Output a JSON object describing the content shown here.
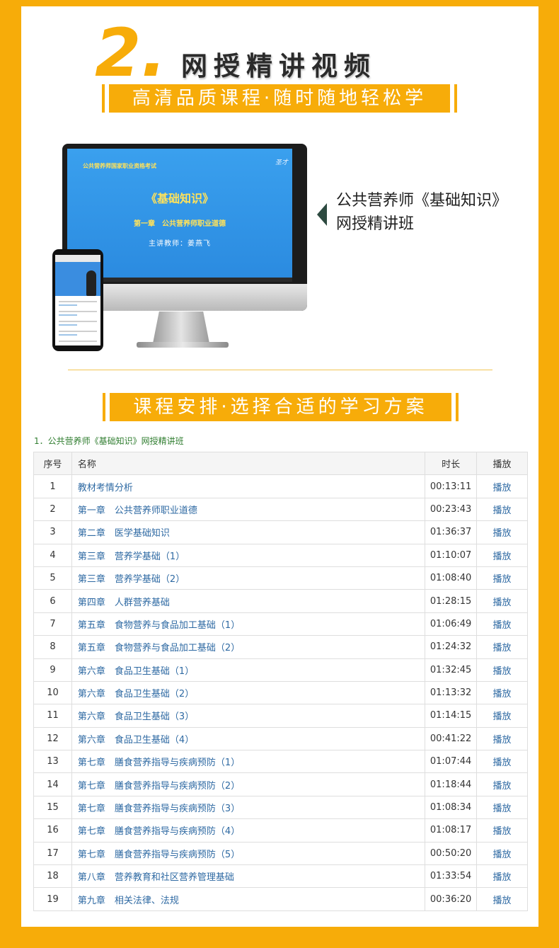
{
  "header": {
    "number": "2.",
    "title": "网授精讲视频",
    "banner": "高清品质课程·随时随地轻松学"
  },
  "device": {
    "screen_top": "公共营养师国家职业资格考试",
    "screen_logo": "圣才",
    "screen_course": "《基础知识》",
    "screen_chapter": "第一章　公共营养师职业道德",
    "screen_teacher": "主讲教师：姜燕飞"
  },
  "product": {
    "line1": "公共营养师《基础知识》",
    "line2": "网授精讲班"
  },
  "section": {
    "banner": "课程安排·选择合适的学习方案",
    "subtitle": "1．公共营养师《基础知识》网授精讲班"
  },
  "table": {
    "headers": [
      "序号",
      "名称",
      "时长",
      "播放"
    ],
    "rows": [
      {
        "no": "1",
        "name": "教材考情分析",
        "duration": "00:13:11",
        "play": "播放"
      },
      {
        "no": "2",
        "name": "第一章　公共营养师职业道德",
        "duration": "00:23:43",
        "play": "播放"
      },
      {
        "no": "3",
        "name": "第二章　医学基础知识",
        "duration": "01:36:37",
        "play": "播放"
      },
      {
        "no": "4",
        "name": "第三章　营养学基础（1）",
        "duration": "01:10:07",
        "play": "播放"
      },
      {
        "no": "5",
        "name": "第三章　营养学基础（2）",
        "duration": "01:08:40",
        "play": "播放"
      },
      {
        "no": "6",
        "name": "第四章　人群营养基础",
        "duration": "01:28:15",
        "play": "播放"
      },
      {
        "no": "7",
        "name": "第五章　食物营养与食品加工基础（1）",
        "duration": "01:06:49",
        "play": "播放"
      },
      {
        "no": "8",
        "name": "第五章　食物营养与食品加工基础（2）",
        "duration": "01:24:32",
        "play": "播放"
      },
      {
        "no": "9",
        "name": "第六章　食品卫生基础（1）",
        "duration": "01:32:45",
        "play": "播放"
      },
      {
        "no": "10",
        "name": "第六章　食品卫生基础（2）",
        "duration": "01:13:32",
        "play": "播放"
      },
      {
        "no": "11",
        "name": "第六章　食品卫生基础（3）",
        "duration": "01:14:15",
        "play": "播放"
      },
      {
        "no": "12",
        "name": "第六章　食品卫生基础（4）",
        "duration": "00:41:22",
        "play": "播放"
      },
      {
        "no": "13",
        "name": "第七章　膳食营养指导与疾病预防（1）",
        "duration": "01:07:44",
        "play": "播放"
      },
      {
        "no": "14",
        "name": "第七章　膳食营养指导与疾病预防（2）",
        "duration": "01:18:44",
        "play": "播放"
      },
      {
        "no": "15",
        "name": "第七章　膳食营养指导与疾病预防（3）",
        "duration": "01:08:34",
        "play": "播放"
      },
      {
        "no": "16",
        "name": "第七章　膳食营养指导与疾病预防（4）",
        "duration": "01:08:17",
        "play": "播放"
      },
      {
        "no": "17",
        "name": "第七章　膳食营养指导与疾病预防（5）",
        "duration": "00:50:20",
        "play": "播放"
      },
      {
        "no": "18",
        "name": "第八章　营养教育和社区营养管理基础",
        "duration": "01:33:54",
        "play": "播放"
      },
      {
        "no": "19",
        "name": "第九章　相关法律、法规",
        "duration": "00:36:20",
        "play": "播放"
      }
    ]
  },
  "colors": {
    "background": "#f7ac09",
    "banner": "#f7ac09",
    "link": "#2f6aa3",
    "subtitle": "#2f7d2f"
  }
}
